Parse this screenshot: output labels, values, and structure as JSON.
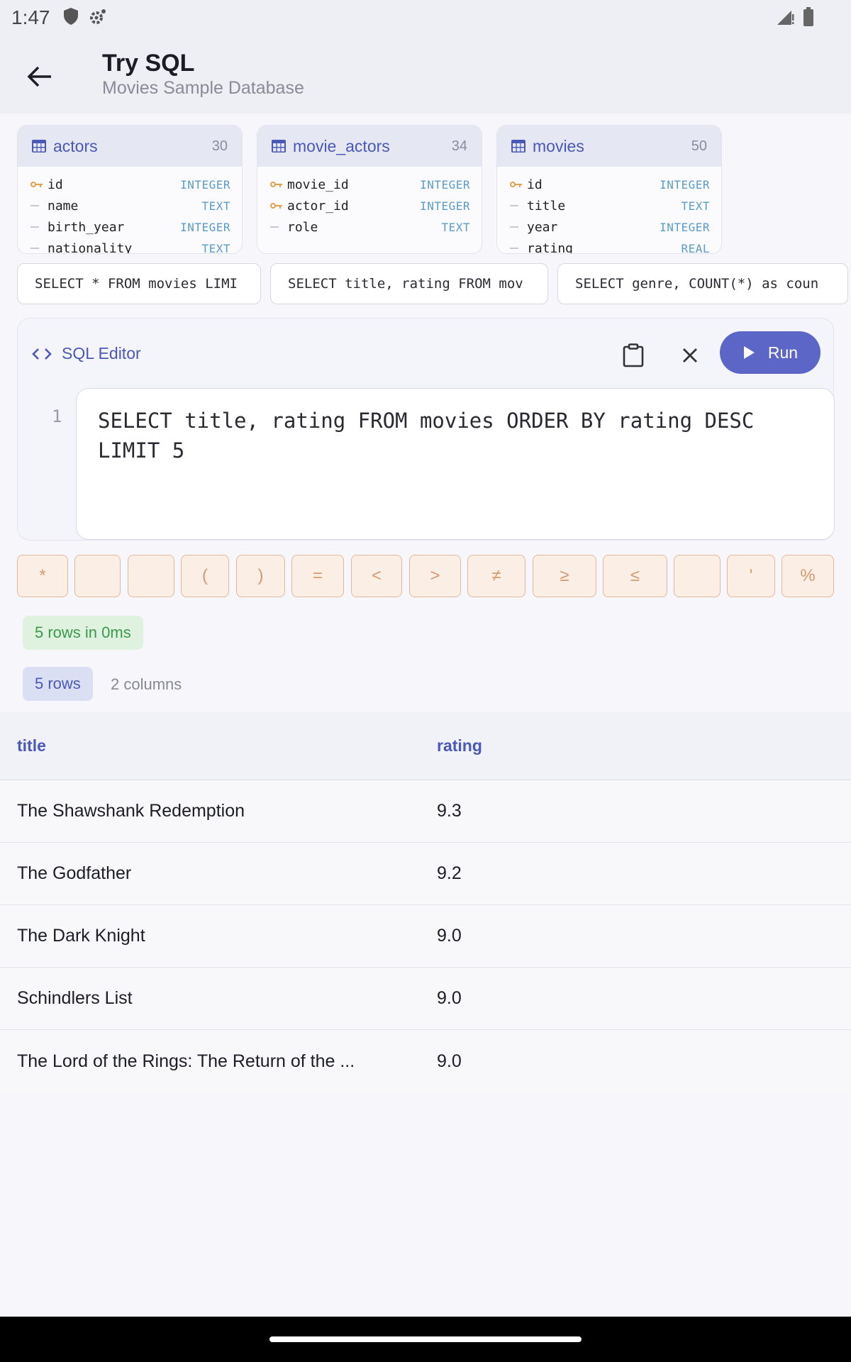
{
  "status_bar": {
    "time": "1:47"
  },
  "app_bar": {
    "title": "Try SQL",
    "subtitle": "Movies Sample Database"
  },
  "schema": {
    "tables": [
      {
        "name": "actors",
        "count": "30",
        "columns": [
          {
            "name": "id",
            "type": "INTEGER",
            "key": true
          },
          {
            "name": "name",
            "type": "TEXT",
            "key": false
          },
          {
            "name": "birth_year",
            "type": "INTEGER",
            "key": false
          },
          {
            "name": "nationality",
            "type": "TEXT",
            "key": false
          }
        ]
      },
      {
        "name": "movie_actors",
        "count": "34",
        "columns": [
          {
            "name": "movie_id",
            "type": "INTEGER",
            "key": true
          },
          {
            "name": "actor_id",
            "type": "INTEGER",
            "key": true
          },
          {
            "name": "role",
            "type": "TEXT",
            "key": false
          }
        ]
      },
      {
        "name": "movies",
        "count": "50",
        "columns": [
          {
            "name": "id",
            "type": "INTEGER",
            "key": true
          },
          {
            "name": "title",
            "type": "TEXT",
            "key": false
          },
          {
            "name": "year",
            "type": "INTEGER",
            "key": false
          },
          {
            "name": "rating",
            "type": "REAL",
            "key": false
          }
        ]
      }
    ]
  },
  "sample_queries": [
    "SELECT * FROM movies LIMI",
    "SELECT title, rating FROM mov",
    "SELECT genre, COUNT(*) as coun"
  ],
  "editor": {
    "label": "SQL Editor",
    "run_label": "Run",
    "line_number": "1",
    "code_line1": "SELECT title, rating FROM movies ORDER BY rating DESC",
    "code_line2": "LIMIT 5"
  },
  "keyboard_keys": [
    "*",
    "",
    "",
    "(",
    ")",
    "=",
    "<",
    ">",
    "≠",
    "≥",
    "≤",
    "",
    "'",
    "%"
  ],
  "result_info": {
    "time_badge": "5 rows in 0ms",
    "rows_badge": "5 rows",
    "columns_label": "2 columns"
  },
  "results": {
    "headers": [
      "title",
      "rating"
    ],
    "rows": [
      [
        "The Shawshank Redemption",
        "9.3"
      ],
      [
        "The Godfather",
        "9.2"
      ],
      [
        "The Dark Knight",
        "9.0"
      ],
      [
        "Schindlers List",
        "9.0"
      ],
      [
        "The Lord of the Rings: The Return of the ...",
        "9.0"
      ]
    ]
  },
  "colors": {
    "accent": "#5b66c6",
    "key_border": "#e0b899",
    "success": "#3a9a4a"
  }
}
